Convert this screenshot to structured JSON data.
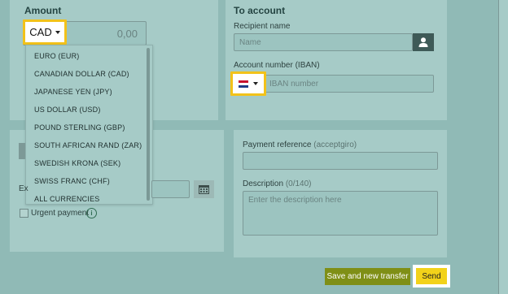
{
  "amount": {
    "label": "Amount",
    "currency": "CAD",
    "value_placeholder": "0,00",
    "currency_options": [
      "EURO  (EUR)",
      "CANADIAN DOLLAR  (CAD)",
      "JAPANESE YEN  (JPY)",
      "US DOLLAR  (USD)",
      "POUND STERLING  (GBP)",
      "SOUTH AFRICAN RAND  (ZAR)",
      "SWEDISH KRONA  (SEK)",
      "SWISS FRANC  (CHF)",
      "ALL CURRENCIES"
    ]
  },
  "to_account": {
    "title": "To account",
    "recipient_label": "Recipient name",
    "recipient_placeholder": "Name",
    "account_label": "Account number (IBAN)",
    "iban_placeholder": "IBAN number",
    "flag_icon": "netherlands-flag-icon"
  },
  "left_lower": {
    "date_label_partial": "Ex",
    "urgent_label": "Urgent payment"
  },
  "payment_reference": {
    "label": "Payment reference",
    "hint": "(acceptgiro)"
  },
  "description": {
    "label": "Description",
    "count": "(0/140)",
    "placeholder": "Enter the description here"
  },
  "buttons": {
    "save_new": "Save and new transfer",
    "send": "Send"
  },
  "colors": {
    "highlight": "#f2c21a",
    "save_button_bg": "#7f8f16",
    "send_button_bg": "#f2d21a",
    "person_icon_bg": "#3e5a57"
  }
}
